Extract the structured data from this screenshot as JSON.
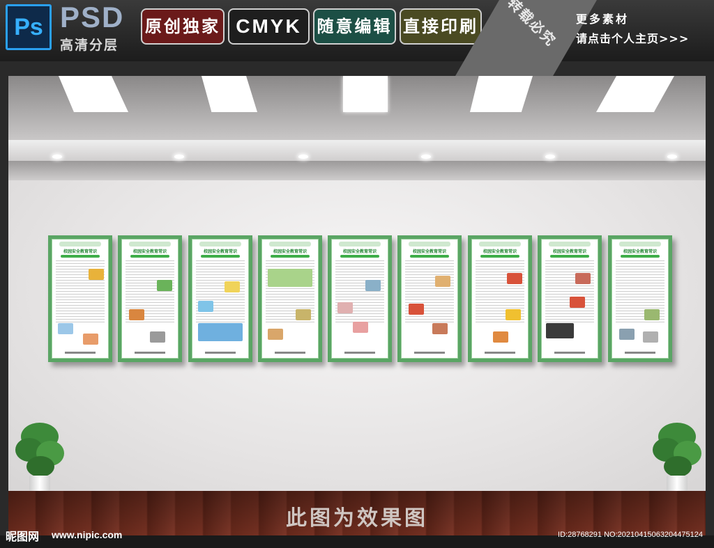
{
  "banner": {
    "ps_logo": "Ps",
    "psd_title": "PSD",
    "psd_subtitle": "高清分层",
    "tags": [
      "原创独家",
      "CMYK",
      "随意编辑",
      "直接印刷"
    ],
    "diagonal_text": "转载必究",
    "more_line1": "更多素材",
    "more_line2": "请点击个人主页>>>"
  },
  "scene": {
    "caption": "此图为效果图",
    "boards": [
      {
        "title": "校园安全教育常识"
      },
      {
        "title": "校园安全教育常识"
      },
      {
        "title": "校园安全教育常识"
      },
      {
        "title": "校园安全教育常识"
      },
      {
        "title": "校园安全教育常识"
      },
      {
        "title": "校园安全教育常识"
      },
      {
        "title": "校园安全教育常识"
      },
      {
        "title": "校园安全教育常识"
      },
      {
        "title": "校园安全教育常识"
      }
    ],
    "accent_color": "#5aa564"
  },
  "footer": {
    "site_name": "昵图网",
    "site_url": "www.nipic.com",
    "id_text": "ID:28768291 NO:20210415063204475124"
  }
}
